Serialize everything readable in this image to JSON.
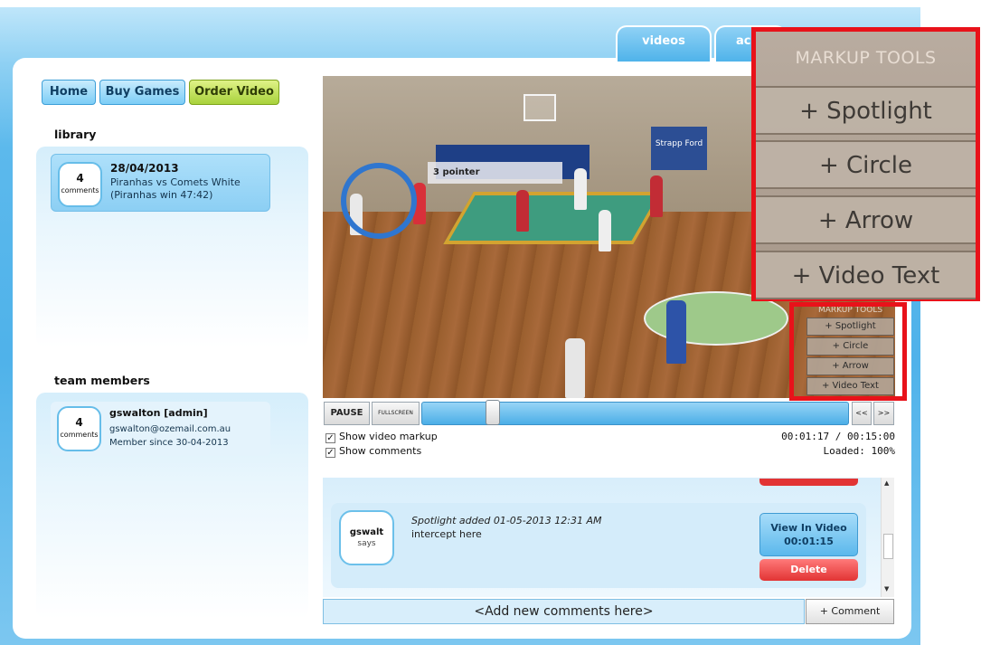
{
  "top_tabs": [
    "videos",
    "ac"
  ],
  "nav": {
    "home": "Home",
    "buy_games": "Buy Games",
    "order_video": "Order Video"
  },
  "library": {
    "title": "library",
    "items": [
      {
        "count": "4",
        "count_label": "comments",
        "date": "28/04/2013",
        "line1": "Piranhas vs Comets White",
        "line2": "(Piranhas win 47:42)"
      }
    ]
  },
  "team": {
    "title": "team members",
    "members": [
      {
        "count": "4",
        "count_label": "comments",
        "name": "gswalton [admin]",
        "email": "gswalton@ozemail.com.au",
        "since": "Member since 30-04-2013"
      }
    ]
  },
  "video": {
    "overlay_text": "3 pointer",
    "sponsor_text": "Strapp Ford",
    "markup_tools": {
      "title": "MARKUP TOOLS",
      "buttons": [
        "+ Spotlight",
        "+ Circle",
        "+ Arrow",
        "+ Video Text"
      ]
    }
  },
  "zoom": {
    "title": "MARKUP TOOLS",
    "buttons": [
      "+ Spotlight",
      "+ Circle",
      "+ Arrow",
      "+ Video Text"
    ]
  },
  "controls": {
    "pause": "PAUSE",
    "fullscreen": "FULLSCREEN",
    "rewind": "<<",
    "forward": ">>",
    "progress": 0.085,
    "time": "00:01:17 / 00:15:00",
    "loaded": "Loaded: 100%",
    "show_markup": "Show video markup",
    "show_comments": "Show comments",
    "check": "✓"
  },
  "comment": {
    "user": "gswalt",
    "says": "says",
    "meta": "Spotlight added 01-05-2013 12:31 AM",
    "text": "intercept here",
    "view_label": "View In Video",
    "view_time": "00:01:15",
    "delete_label": "Delete"
  },
  "add_comment": {
    "placeholder": "<Add new comments here>",
    "button": "+ Comment"
  },
  "colors": {
    "accent_blue": "#4fb2ea",
    "accent_green": "#a9d23c",
    "delete_red": "#e23434",
    "highlight_red": "#e8121a"
  }
}
